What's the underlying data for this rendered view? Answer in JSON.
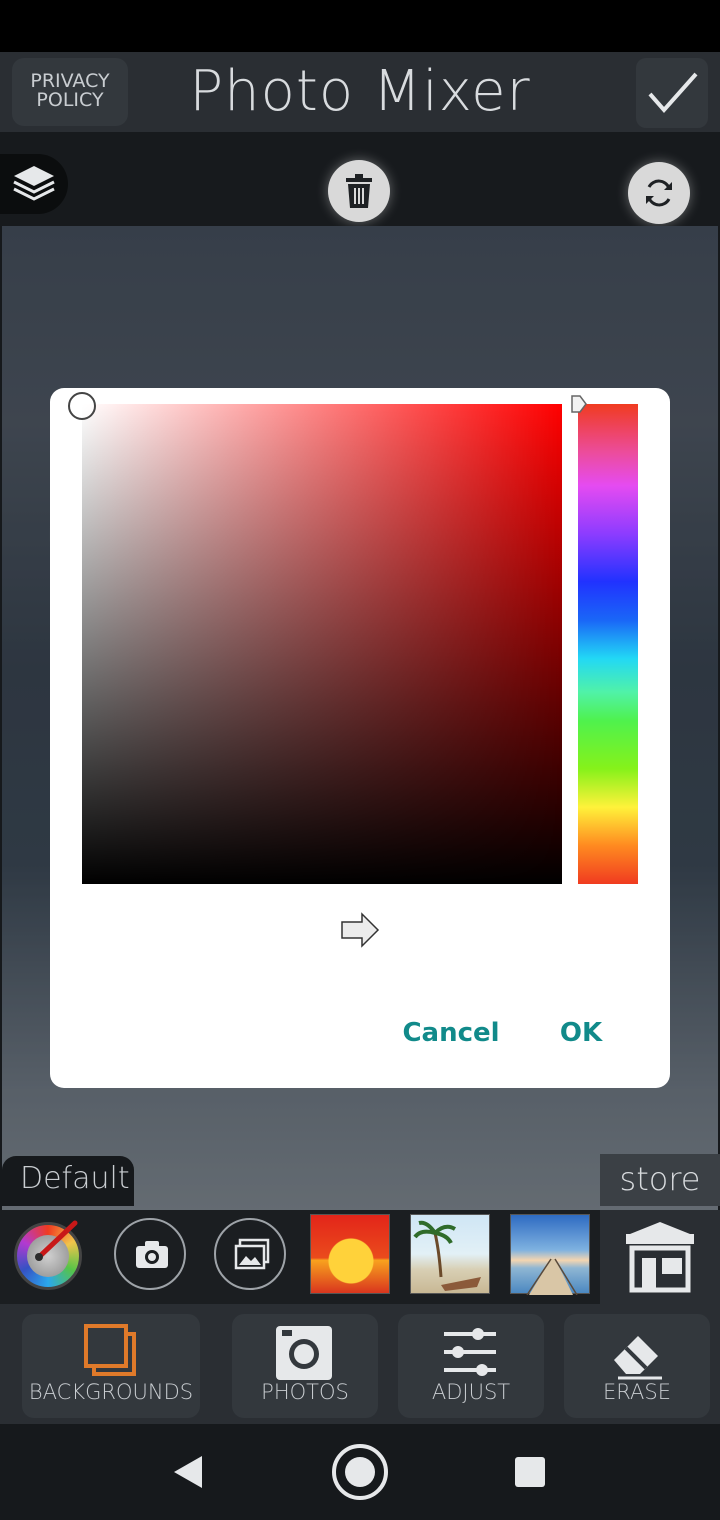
{
  "topbar": {
    "privacy_line1": "PRIVACY",
    "privacy_line2": "POLICY",
    "title": "Photo Mixer"
  },
  "canvas": {
    "default_tab": "Default",
    "store_tab": "store"
  },
  "color_picker": {
    "selected_hue": "#ff0000",
    "cancel_label": "Cancel",
    "ok_label": "OK"
  },
  "bottom_nav": {
    "items": [
      {
        "label": "BACKGROUNDS",
        "icon": "backgrounds-icon"
      },
      {
        "label": "PHOTOS",
        "icon": "camera-icon"
      },
      {
        "label": "ADJUST",
        "icon": "sliders-icon"
      },
      {
        "label": "ERASE",
        "icon": "eraser-icon"
      }
    ]
  },
  "colors": {
    "accent_teal": "#118a8a",
    "active_orange": "#e07a2a",
    "topbar_bg": "#2a2e33"
  }
}
